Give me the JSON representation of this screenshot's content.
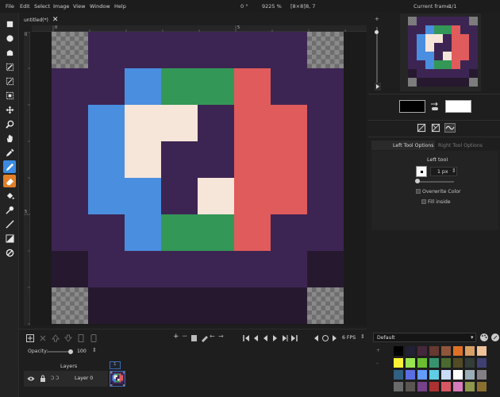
{
  "menu": [
    "File",
    "Edit",
    "Select",
    "Image",
    "View",
    "Window",
    "Help"
  ],
  "status": {
    "rotation": "0 °",
    "zoom": "9225 %",
    "size": "[8×8]",
    "cursor": "8, 7"
  },
  "current_frame_label": "Current frame:",
  "current_frame_value": "1/1",
  "tab": {
    "title": "untitled(*)",
    "close": "✕"
  },
  "ruler": {
    "top_zero": "0",
    "top_five": "5",
    "left_zero": "0",
    "left_five": "5"
  },
  "tools": [
    "rectangle-select-icon",
    "ellipse-select-icon",
    "lasso-select-icon",
    "magic-wand-icon",
    "color-select-icon",
    "pixel-select-icon",
    "move-icon",
    "zoom-icon",
    "pan-icon",
    "color-picker-icon",
    "pencil-icon",
    "eraser-icon",
    "bucket-icon",
    "shading-icon",
    "line-icon",
    "rectangle-icon",
    "ellipse-icon"
  ],
  "colors": {
    "left": "#000000",
    "right": "#ffffff",
    "left_active": "#3c8be0",
    "right_active": "#e07f28"
  },
  "tool_options": {
    "tabs": [
      "Left Tool Options",
      "Right Tool Options"
    ],
    "heading": "Left tool",
    "brush_size": "1 px",
    "overwrite_color": "Overwrite Color",
    "fill_inside": "Fill inside"
  },
  "palette": {
    "name": "Default",
    "colors": [
      "#000000",
      "#222034",
      "#45283c",
      "#663931",
      "#8f563b",
      "#df7126",
      "#d9a066",
      "#eec39a",
      "#fbf236",
      "#99e550",
      "#6abe30",
      "#37946e",
      "#4b692f",
      "#524b24",
      "#323c39",
      "#3f3f74",
      "#306082",
      "#5b6ee1",
      "#639bff",
      "#5fcde4",
      "#cbdbfc",
      "#ffffff",
      "#9badb7",
      "#847e87",
      "#696a6a",
      "#595652",
      "#76428a",
      "#ac3232",
      "#d95763",
      "#d77bba",
      "#8f974a",
      "#8a6f30"
    ]
  },
  "animation": {
    "fps": "6 FPS"
  },
  "layers": {
    "opacity_label": "Opacity:",
    "opacity_value": "100",
    "frame_number": "1",
    "header": "Layers",
    "layer_name": "Layer 0"
  },
  "image_pixels": [
    "...........",
    ".BBGGRR..",
    "BCCC.RRR",
    "BC...RRR",
    "BB..CRR",
    ".BGGR",
    "",
    ""
  ],
  "pixel_colors": {
    "bg": "#3d2553",
    "blue": "#4a8ee0",
    "green": "#339757",
    "red": "#e05b5b",
    "cream": "#f6e5d9",
    "dark": "#26192f"
  }
}
